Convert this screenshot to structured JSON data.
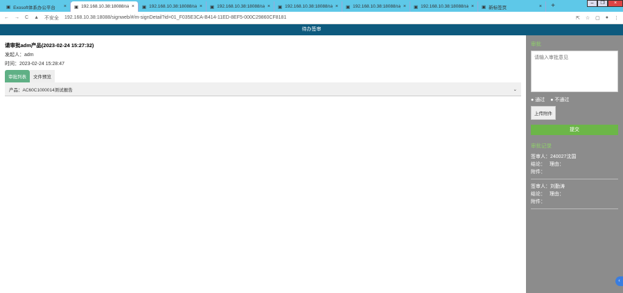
{
  "browser": {
    "tabs": [
      {
        "title": "Exosoft体系办公平台",
        "active": false
      },
      {
        "title": "192.168.10.38:18088/sign",
        "active": true
      },
      {
        "title": "192.168.10.38:18088/sign",
        "active": false
      },
      {
        "title": "192.168.10.38:18088/sign",
        "active": false
      },
      {
        "title": "192.168.10.38:18088/sign",
        "active": false
      },
      {
        "title": "192.168.10.38:18088/sign",
        "active": false
      },
      {
        "title": "192.168.10.38:18088/sign",
        "active": false
      },
      {
        "title": "新标签页",
        "active": false
      }
    ],
    "security": "不安全",
    "url": "192.168.10.38:18088/signweb/#/m-signDetail?id=01_F035E3CA-B414-11ED-8EF5-000C29860CF8181"
  },
  "header": {
    "title": "待办签审"
  },
  "main": {
    "title": "请审批adm产品(2023-02-24 15:27:32)",
    "initiator": "发起人：adm",
    "time": "时间：2023-02-24 15:28:47",
    "tabs": [
      "审批列表",
      "文件预览"
    ],
    "product": "产品：AC60C1000014测试报告"
  },
  "side": {
    "heading": "审批",
    "placeholder": "请输入审批意见",
    "approve": "通过",
    "reject": "不通过",
    "upload": "上传附件",
    "submit": "提交",
    "records_title": "审批记录",
    "records": [
      {
        "signer": "签审人：240027沈国",
        "conclusion": "结论：",
        "reason": "理由：",
        "attachment": "附件："
      },
      {
        "signer": "签审人：刘勤涛",
        "conclusion": "结论：",
        "reason": "理由：",
        "attachment": "附件："
      }
    ]
  }
}
